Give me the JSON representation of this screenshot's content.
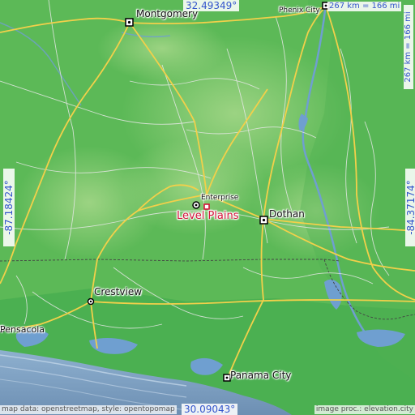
{
  "map": {
    "feature": {
      "name": "Level Plains"
    },
    "cities": [
      {
        "name": "Montgomery"
      },
      {
        "name": "Phenix City"
      },
      {
        "name": "Enterprise"
      },
      {
        "name": "Dothan"
      },
      {
        "name": "Crestview"
      },
      {
        "name": "Pensacola"
      },
      {
        "name": "Panama City"
      }
    ],
    "coordinates": {
      "top": "32.49349°",
      "bottom": "30.09043°",
      "left": "-87.18424°",
      "right": "-84.37174°"
    },
    "scale": {
      "horizontal": "267 km = 166 mi",
      "vertical": "267 km = 166 mi"
    },
    "attribution": {
      "left": "map data: openstreetmap, style: opentopomap",
      "right": "image proc.: elevation.city"
    },
    "colors": {
      "land_green": "#5fbe5c",
      "highland_green": "#8fcd78",
      "sea": "#7d9ebf",
      "water": "#6f9fd0",
      "road_major": "#f2d04a",
      "road_minor": "#e8e8e8",
      "border": "#555555",
      "feature_red": "#d4143a",
      "coord_blue": "#3355cc"
    }
  }
}
